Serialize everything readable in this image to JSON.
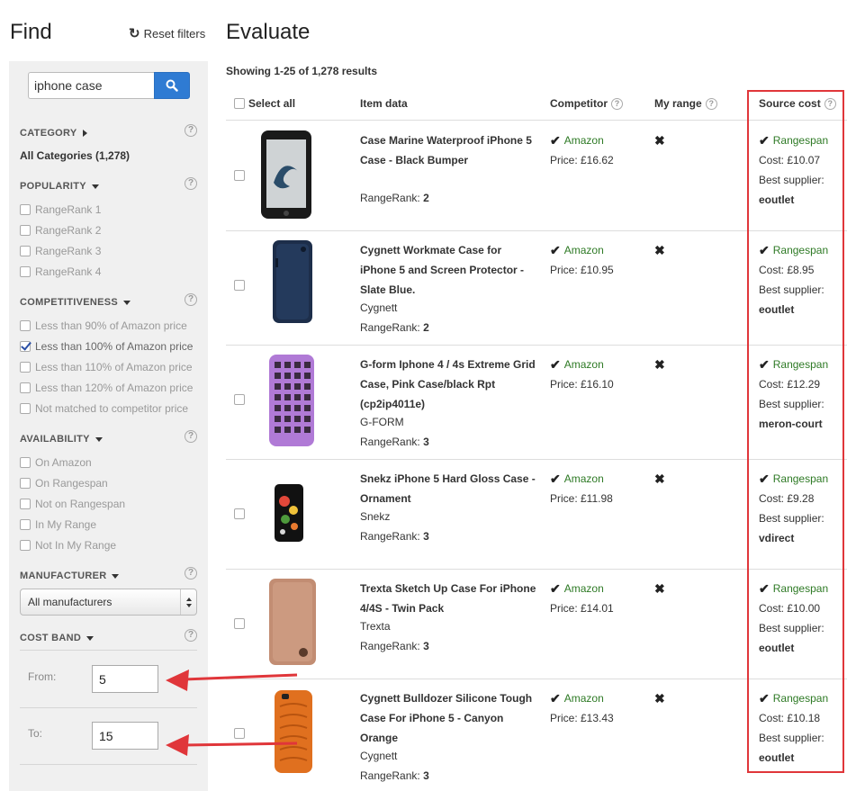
{
  "find": {
    "title": "Find",
    "reset_label": "Reset filters",
    "search_value": "iphone case",
    "search_placeholder": ""
  },
  "filters": {
    "category": {
      "heading": "CATEGORY",
      "all_label": "All Categories (1,278)"
    },
    "popularity": {
      "heading": "POPULARITY",
      "options": [
        "RangeRank 1",
        "RangeRank 2",
        "RangeRank 3",
        "RangeRank 4"
      ]
    },
    "competitiveness": {
      "heading": "COMPETITIVENESS",
      "options": [
        "Less than 90% of Amazon price",
        "Less than 100% of Amazon price",
        "Less than 110% of Amazon price",
        "Less than 120% of Amazon price",
        "Not matched to competitor price"
      ],
      "checked_index": 1
    },
    "availability": {
      "heading": "AVAILABILITY",
      "options": [
        "On Amazon",
        "On Rangespan",
        "Not on Rangespan",
        "In My Range",
        "Not In My Range"
      ]
    },
    "manufacturer": {
      "heading": "MANUFACTURER",
      "selected": "All manufacturers"
    },
    "cost_band": {
      "heading": "COST BAND",
      "from_label": "From:",
      "from_value": "5",
      "to_label": "To:",
      "to_value": "15"
    },
    "help_glyph": "?"
  },
  "evaluate": {
    "title": "Evaluate",
    "showing": "Showing 1-25 of 1,278 results",
    "headers": {
      "select_all": "Select all",
      "item_data": "Item data",
      "competitor": "Competitor",
      "my_range": "My range",
      "source_cost": "Source cost"
    },
    "rows": [
      {
        "title": "Case Marine Waterproof iPhone 5 Case - Black Bumper",
        "brand": "",
        "rangerank_label": "RangeRank:",
        "rangerank": "2",
        "competitor": "Amazon",
        "price": "Price: £16.62",
        "my_range": "✖",
        "source": "Rangespan",
        "cost": "Cost: £10.07",
        "supplier_label": "Best supplier:",
        "supplier": "eoutlet"
      },
      {
        "title": "Cygnett Workmate Case for iPhone 5 and Screen Protector - Slate Blue.",
        "brand": "Cygnett",
        "rangerank_label": "RangeRank:",
        "rangerank": "2",
        "competitor": "Amazon",
        "price": "Price: £10.95",
        "my_range": "✖",
        "source": "Rangespan",
        "cost": "Cost: £8.95",
        "supplier_label": "Best supplier:",
        "supplier": "eoutlet"
      },
      {
        "title": "G-form Iphone 4 / 4s Extreme Grid Case, Pink Case/black Rpt (cp2ip4011e)",
        "brand": "G-FORM",
        "rangerank_label": "RangeRank:",
        "rangerank": "3",
        "competitor": "Amazon",
        "price": "Price: £16.10",
        "my_range": "✖",
        "source": "Rangespan",
        "cost": "Cost: £12.29",
        "supplier_label": "Best supplier:",
        "supplier": "meron-court"
      },
      {
        "title": "Snekz iPhone 5 Hard Gloss Case - Ornament",
        "brand": "Snekz",
        "rangerank_label": "RangeRank:",
        "rangerank": "3",
        "competitor": "Amazon",
        "price": "Price: £11.98",
        "my_range": "✖",
        "source": "Rangespan",
        "cost": "Cost: £9.28",
        "supplier_label": "Best supplier:",
        "supplier": "vdirect"
      },
      {
        "title": "Trexta Sketch Up Case For iPhone 4/4S - Twin Pack",
        "brand": "Trexta",
        "rangerank_label": "RangeRank:",
        "rangerank": "3",
        "competitor": "Amazon",
        "price": "Price: £14.01",
        "my_range": "✖",
        "source": "Rangespan",
        "cost": "Cost: £10.00",
        "supplier_label": "Best supplier:",
        "supplier": "eoutlet"
      },
      {
        "title": "Cygnett Bulldozer Silicone Tough Case For iPhone 5 - Canyon Orange",
        "brand": "Cygnett",
        "rangerank_label": "RangeRank:",
        "rangerank": "3",
        "competitor": "Amazon",
        "price": "Price: £13.43",
        "my_range": "✖",
        "source": "Rangespan",
        "cost": "Cost: £10.18",
        "supplier_label": "Best supplier:",
        "supplier": "eoutlet"
      }
    ]
  },
  "colors": {
    "accent_blue": "#2f7bd3",
    "ok_green": "#2e7a25",
    "highlight_red": "#e0363a",
    "sidebar_bg": "#f0f0f0"
  },
  "icons": {
    "reset": "refresh-icon",
    "search": "magnifier-icon",
    "check": "checkmark-icon",
    "cross": "cross-icon",
    "help": "question-circle-icon"
  }
}
